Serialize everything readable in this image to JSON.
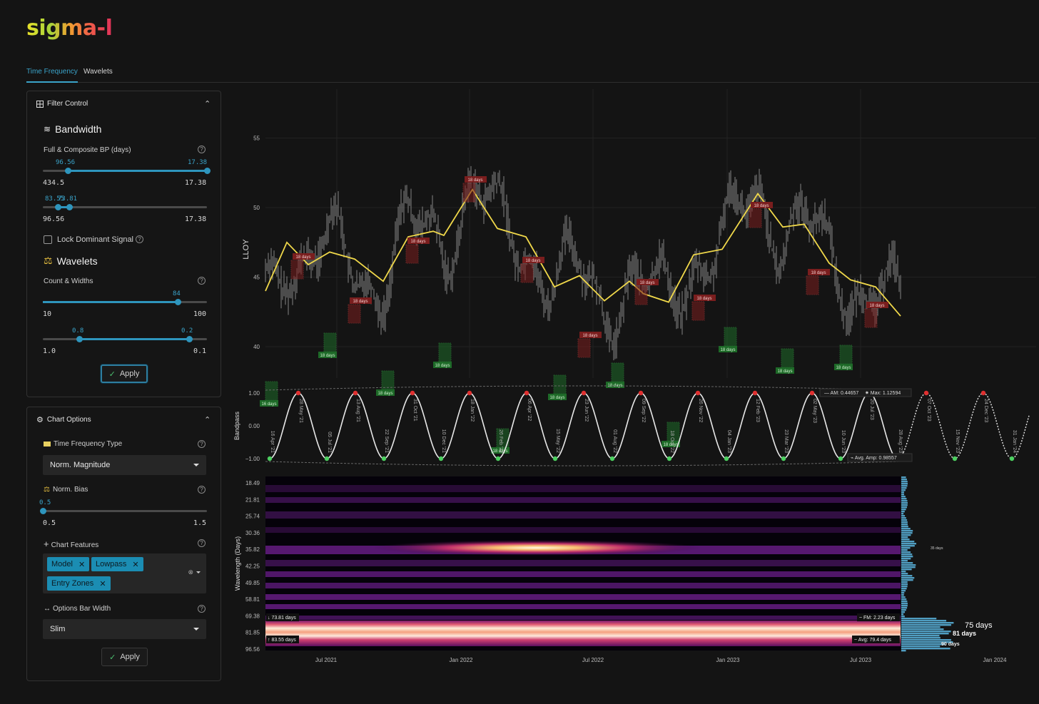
{
  "app": {
    "logo": "sigma-l"
  },
  "tabs": [
    {
      "label": "Time Frequency",
      "active": true
    },
    {
      "label": "Wavelets",
      "active": false
    }
  ],
  "filter_control": {
    "title": "Filter Control",
    "bandwidth_title": "Bandwidth",
    "bp_label": "Full & Composite BP (days)",
    "slider1": {
      "low_value": "96.56",
      "high_value": "17.38",
      "min": "434.5",
      "max": "17.38",
      "low_frac": 0.15,
      "high_frac": 1.0
    },
    "slider2": {
      "low_value": "83.55",
      "high_value": "73.81",
      "min": "96.56",
      "max": "17.38",
      "low_frac": 0.09,
      "high_frac": 0.16
    },
    "lock_label": "Lock Dominant Signal",
    "wavelets_title": "Wavelets",
    "count_label": "Count & Widths",
    "slider3": {
      "value": "84",
      "min": "10",
      "max": "100",
      "frac": 0.82
    },
    "slider4": {
      "low_value": "0.8",
      "high_value": "0.2",
      "min": "1.0",
      "max": "0.1",
      "low_frac": 0.22,
      "high_frac": 0.89
    },
    "apply": "Apply"
  },
  "chart_options": {
    "title": "Chart Options",
    "tf_type_label": "Time Frequency Type",
    "tf_type_value": "Norm. Magnitude",
    "bias_label": "Norm. Bias",
    "bias": {
      "value": "0.5",
      "min": "0.5",
      "max": "1.5",
      "frac": 0.0
    },
    "features_label": "Chart Features",
    "features": [
      "Model",
      "Lowpass",
      "Entry Zones"
    ],
    "bar_width_label": "Options Bar Width",
    "bar_width_value": "Slim",
    "apply": "Apply"
  },
  "price_chart": {
    "ylabel": "LLOY",
    "yticks": [
      40,
      45,
      50,
      55
    ],
    "ylim": [
      38,
      58
    ],
    "peak_label": "18 days",
    "trough_labels": [
      "16 days",
      "18 days"
    ],
    "line_color": "#f0d84a",
    "price_color": "#9a9a9a",
    "peak_color": "#7a1e1e",
    "trough_color": "#1e6a28"
  },
  "bandpass_chart": {
    "ylabel": "Bandpass",
    "yticks": [
      "1.00",
      "0.00",
      "−1.00"
    ],
    "am_label": "AM: 0.44657",
    "max_label": "Max: 1.12594",
    "avg_amp_label": "Avg. Amp: 0.98557",
    "dates": [
      "16 Apr '21",
      "28 May '21",
      "05 Jul '21",
      "13 Aug '21",
      "22 Sep '21",
      "31 Oct '21",
      "10 Dec '21",
      "18 Jan '22",
      "26 Feb '22",
      "06 Apr '22",
      "15 May '22",
      "23 Jun '22",
      "01 Aug '22",
      "09 Sep '22",
      "18 Oct '22",
      "26 Nov '22",
      "04 Jan '23",
      "12 Feb '23",
      "23 Mar '23",
      "02 May '23",
      "10 Jun '23",
      "20 Jul '23",
      "28 Aug '23",
      "07 Oct '23",
      "15 Nov '23",
      "24 Dec '23",
      "31 Jan '24"
    ]
  },
  "spectrum_chart": {
    "ylabel": "Wavelength (Days)",
    "yticks": [
      "18.49",
      "21.81",
      "25.74",
      "30.36",
      "35.82",
      "42.25",
      "49.85",
      "58.81",
      "69.38",
      "81.85",
      "96.56"
    ],
    "xticks": [
      "Jul 2021",
      "Jan 2022",
      "Jul 2022",
      "Jan 2023",
      "Jul 2023",
      "Jan 2024"
    ],
    "upper_band": "73.81 days",
    "lower_band": "83.55 days",
    "fm_label": "FM: 2.23 days",
    "avg_label": "Avg: 79.4 days",
    "peak_labels": {
      "p35": "35 days",
      "p75": "75 days",
      "p81": "81 days",
      "p90": "90 days"
    }
  }
}
